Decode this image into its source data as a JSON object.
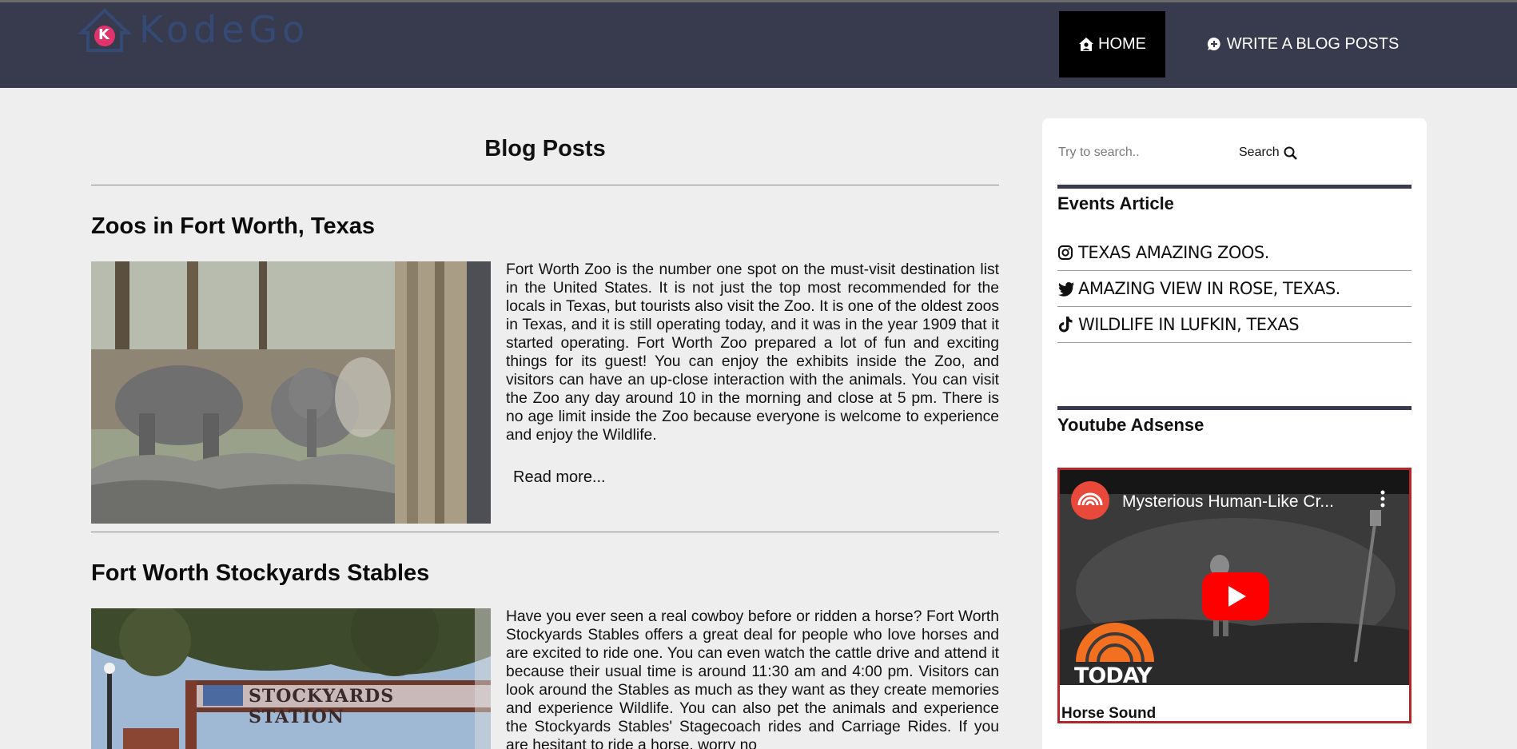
{
  "header": {
    "logo_text": "KodeGo",
    "logo_letter": "K",
    "nav": {
      "home_label": "HOME",
      "write_label": "WRITE A BLOG POSTS"
    }
  },
  "main": {
    "page_title": "Blog Posts",
    "posts": [
      {
        "title": "Zoos in Fort Worth, Texas",
        "body": "Fort Worth Zoo is the number one spot on the must-visit destination list in the United States. It is not just the top most recommended for the locals in Texas, but tourists also visit the Zoo. It is one of the oldest zoos in Texas, and it is still operating today, and it was in the year 1909 that it started operating. Fort Worth Zoo prepared a lot of fun and exciting things for its guest! You can enjoy the exhibits inside the Zoo, and visitors can have an up-close interaction with the animals. You can visit the Zoo any day around 10 in the morning and close at 5 pm. There is no age limit inside the Zoo because everyone is welcome to experience and enjoy the Wildlife.",
        "read_more": "Read more..."
      },
      {
        "title": "Fort Worth Stockyards Stables",
        "body": "Have you ever seen a real cowboy before or ridden a horse? Fort Worth Stockyards Stables offers a great deal for people who love horses and are excited to ride one. You can even watch the cattle drive and attend it because their usual time is around 11:30 am and 4:00 pm. Visitors can look around the Stables as much as they want as they create memories and experience Wildlife. You can also pet the animals and experience the Stockyards Stables' Stagecoach rides and Carriage Rides. If you are hesitant to ride a horse, worry no",
        "sign_text": "STOCKYARDS STATION"
      }
    ]
  },
  "sidebar": {
    "search": {
      "placeholder": "Try to search..",
      "button_label": "Search"
    },
    "events": {
      "title": "Events Article",
      "items": [
        {
          "label": "Texas Amazing Zoos.",
          "icon": "instagram-icon"
        },
        {
          "label": "Amazing View in Rose, Texas.",
          "icon": "twitter-icon"
        },
        {
          "label": "Wildlife in Lufkin, Texas",
          "icon": "tiktok-icon"
        }
      ]
    },
    "youtube": {
      "title": "Youtube Adsense",
      "video_title": "Mysterious Human-Like Cr...",
      "channel_badge": "TODAY",
      "caption": "Horse Sound"
    }
  },
  "colors": {
    "header_bg": "#383a4d",
    "page_bg": "#eeeeee",
    "active_nav_bg": "#000000",
    "youtube_red": "#ff0000",
    "frame_border": "#b3262a"
  }
}
